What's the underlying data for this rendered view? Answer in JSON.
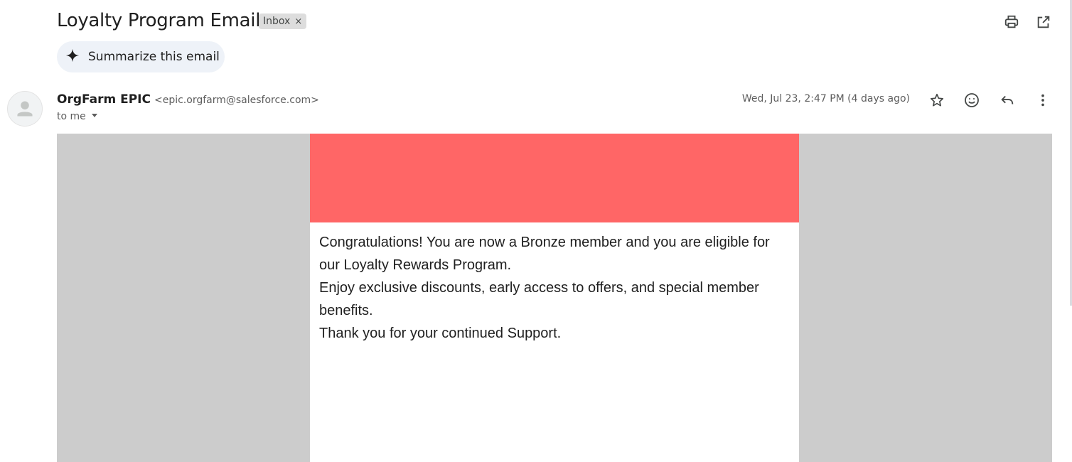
{
  "subject": "Loyalty Program Email",
  "label_chip": {
    "text": "Inbox",
    "close": "×"
  },
  "toolbar": {
    "print_icon": "print-icon",
    "open_new_window_icon": "open-in-new-icon"
  },
  "summarize_button": {
    "label": "Summarize this email",
    "icon": "sparkle-icon"
  },
  "sender": {
    "name": "OrgFarm EPIC",
    "email": "<epic.orgfarm@salesforce.com>",
    "to": "to me"
  },
  "date": "Wed, Jul 23, 2:47 PM (4 days ago)",
  "actions": [
    "star-icon",
    "emoji-icon",
    "reply-icon",
    "more-vert-icon"
  ],
  "email_body": {
    "banner_color": "#ff6666",
    "background_color": "#cccccc",
    "lines": [
      "Congratulations! You are now a Bronze member and you are eligible for our Loyalty Rewards Program.",
      "Enjoy exclusive discounts, early access to offers, and special member benefits.",
      "Thank you for your continued Support."
    ]
  }
}
